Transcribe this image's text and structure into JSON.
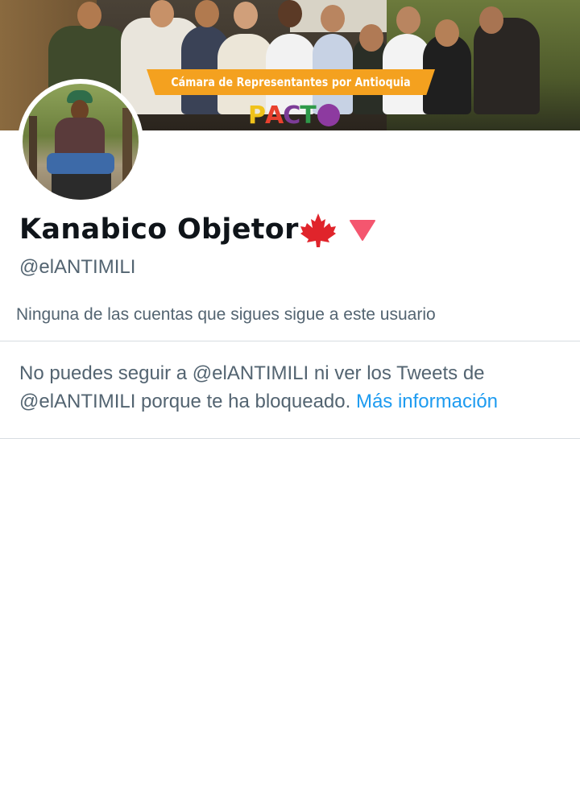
{
  "header": {
    "banner_caption": "Cámara de Representantes por Antioquia",
    "banner_logo_text": "PACTO"
  },
  "profile": {
    "display_name": "Kanabico Objetor",
    "name_icons": [
      "maple-leaf-icon",
      "red-triangle-icon"
    ],
    "handle": "@elANTIMILI",
    "followers_you_know": "Ninguna de las cuentas que sigues sigue a este usuario"
  },
  "blocked_notice": {
    "text": "No puedes seguir a @elANTIMILI ni ver los Tweets de @elANTIMILI porque te ha bloqueado.",
    "link_label": "Más información"
  },
  "colors": {
    "accent_link": "#1d9bf0",
    "secondary_text": "#536471",
    "primary_text": "#0f1419",
    "maple_leaf": "#e0242b",
    "triangle": "#f4566f",
    "banner_strip": "#f4a11f"
  }
}
